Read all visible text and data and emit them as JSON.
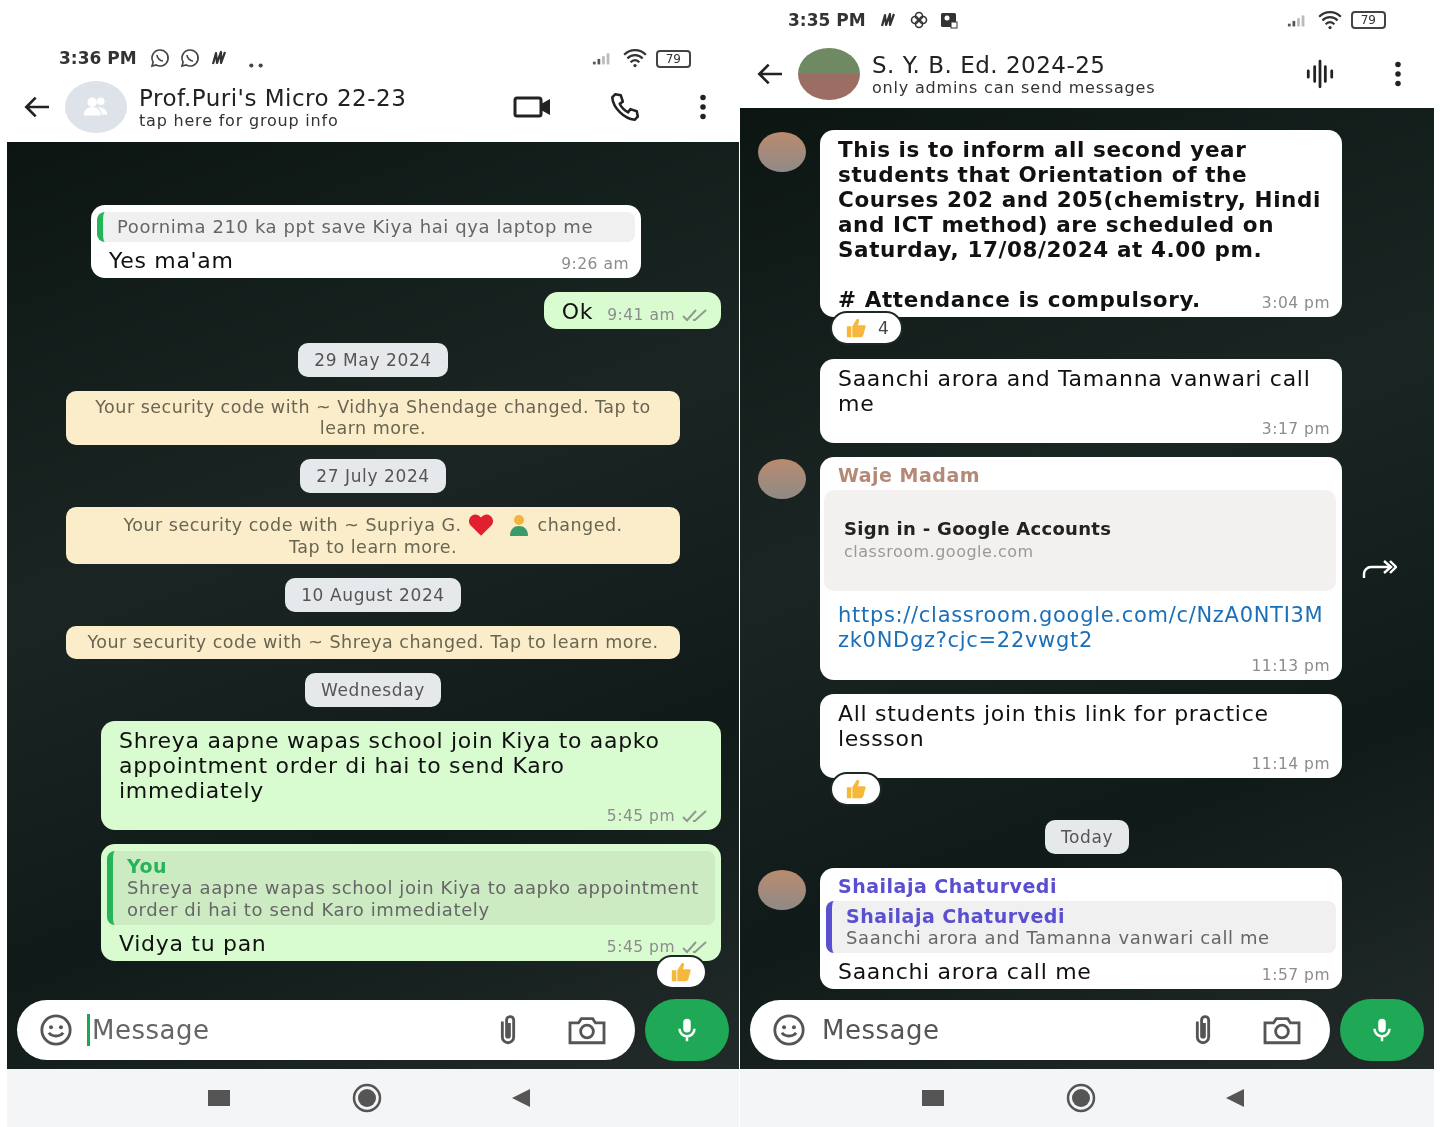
{
  "phones": [
    {
      "status": {
        "time": "3:36 PM",
        "battery": "79"
      },
      "header": {
        "title": "Prof.Puri's Micro 22-23",
        "subtitle": "tap here for group info"
      },
      "messages": [
        {
          "kind": "in",
          "quote": {
            "text": "Poornima 210 ka ppt save Kiya hai qya laptop me",
            "color": "#25b45a"
          },
          "text": "Yes ma'am",
          "time": "9:26 am"
        },
        {
          "kind": "out",
          "text": "Ok",
          "time": "9:41 am",
          "read": false
        },
        {
          "kind": "date",
          "text": "29 May 2024"
        },
        {
          "kind": "system",
          "text": "Your security code with ~ Vidhya Shendage changed. Tap to learn more."
        },
        {
          "kind": "date",
          "text": "27 July 2024"
        },
        {
          "kind": "system",
          "text": "Your security code with ~ Supriya G.",
          "after": "changed.",
          "line2": "Tap to learn more."
        },
        {
          "kind": "date",
          "text": "10 August 2024"
        },
        {
          "kind": "system",
          "text": "Your security code with ~ Shreya changed. Tap to learn more."
        },
        {
          "kind": "date",
          "text": "Wednesday"
        },
        {
          "kind": "out",
          "text": "Shreya aapne wapas school join Kiya to aapko appointment order di hai to send Karo immediately",
          "time": "5:45 pm",
          "read": false
        },
        {
          "kind": "out",
          "quote": {
            "sender": "You",
            "text": "Shreya aapne wapas school join Kiya to aapko appointment order di hai to send Karo immediately",
            "color": "#25b45a"
          },
          "text": "Vidya tu pan",
          "time": "5:45 pm",
          "read": false,
          "reacted": true
        }
      ],
      "composer": {
        "placeholder": "Message",
        "focused": true
      }
    },
    {
      "status": {
        "time": "3:35 PM",
        "battery": "79"
      },
      "header": {
        "title": "S. Y. B. Ed. 2024-25",
        "subtitle": "only admins can send messages"
      },
      "messages": [
        {
          "kind": "in",
          "avatar": true,
          "bold": true,
          "paragraphs": [
            "This is to inform all second year students  that Orientation of the Courses 202 and 205(chemistry, Hindi and ICT method) are scheduled on Saturday, 17/08/2024 at 4.00 pm.",
            "# Attendance is compulsory."
          ],
          "time": "3:04 pm",
          "reacted": true,
          "reaction_count": "4"
        },
        {
          "kind": "in",
          "text": "Saanchi arora and Tamanna vanwari call me",
          "time": "3:17 pm"
        },
        {
          "kind": "in",
          "avatar": true,
          "sender": "Waje Madam",
          "color": "#b48a76",
          "preview": {
            "title": "Sign in - Google Accounts",
            "domain": "classroom.google.com"
          },
          "link": "https://classroom.google.com/c/NzA0NTI3Mzk0NDgz?cjc=22vwgt2",
          "time": "11:13 pm",
          "forward": true
        },
        {
          "kind": "in",
          "text": "All students join this link for practice lessson",
          "time": "11:14 pm",
          "reacted": true
        },
        {
          "kind": "date",
          "text": "Today"
        },
        {
          "kind": "in",
          "avatar": true,
          "sender": "Shailaja Chaturvedi",
          "color": "#5a4fd0",
          "quote": {
            "sender": "Shailaja Chaturvedi",
            "text": "Saanchi arora and Tamanna vanwari call me",
            "color": "#5a4fd0"
          },
          "text": "Saanchi arora call me",
          "time": "1:57 pm"
        }
      ],
      "composer": {
        "placeholder": "Message",
        "focused": false
      }
    }
  ]
}
